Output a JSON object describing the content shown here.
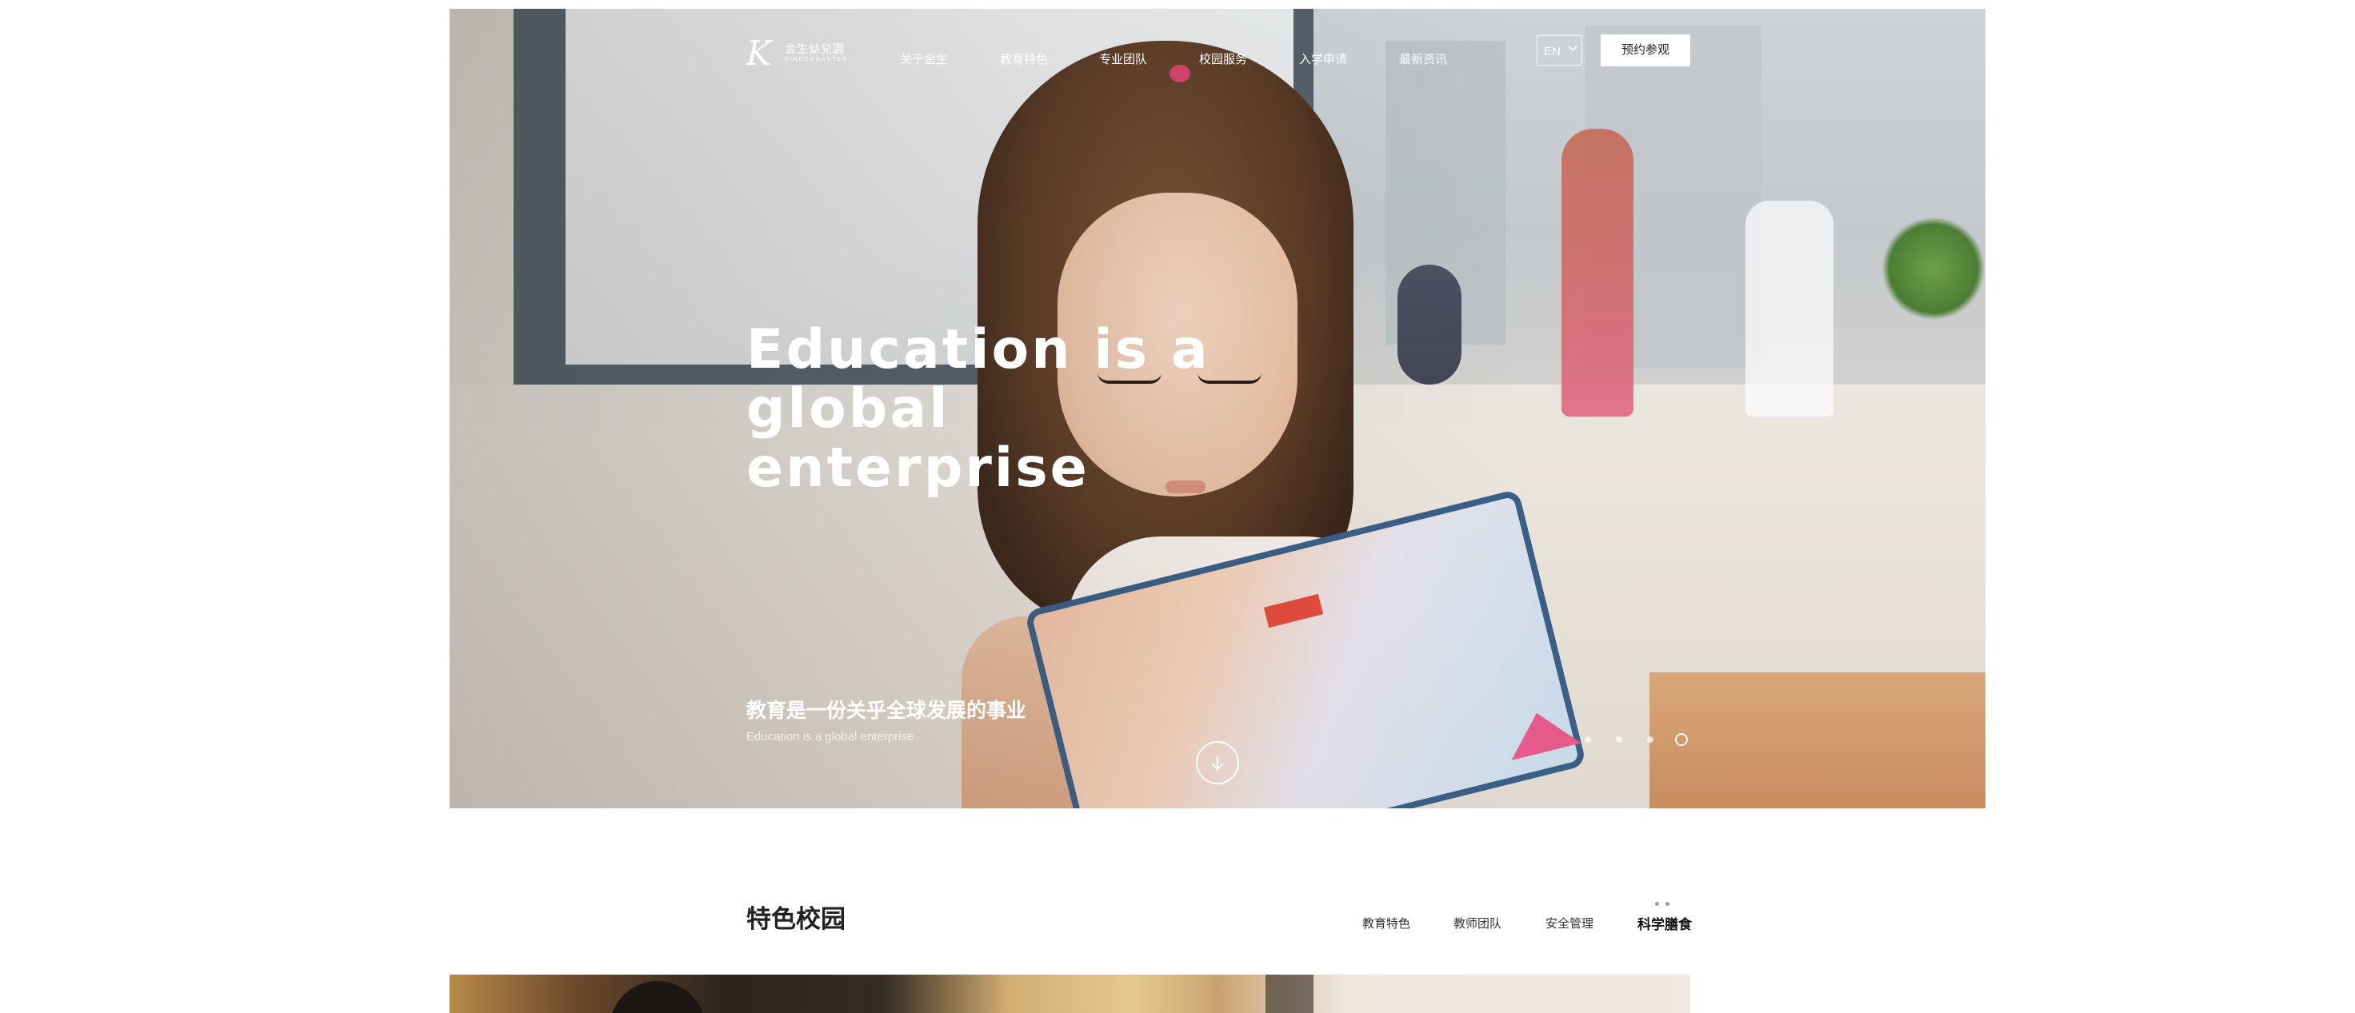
{
  "brand": {
    "logo_mark": "K",
    "name_cn": "金生幼兒園",
    "name_en": "KINDERGARTEN"
  },
  "nav": {
    "items": [
      "关于金生",
      "教育特色",
      "专业团队",
      "校园服务",
      "入学申请",
      "最新资讯"
    ],
    "language": "EN",
    "language_icon": "chevron-down-icon",
    "cta": "预约参观"
  },
  "hero": {
    "title_line1": "Education is a",
    "title_line2": "global enterprise",
    "subtitle_cn": "教育是一份关乎全球发展的事业",
    "subtitle_en": "Education is a global enterprise",
    "scroll_icon": "arrow-down-icon",
    "slides_total": 4,
    "slide_active": 4
  },
  "feature_section": {
    "title": "特色校园",
    "tabs": [
      "教育特色",
      "教师团队",
      "安全管理",
      "科学膳食"
    ],
    "active_tab": "科学膳食"
  },
  "colors": {
    "text_dark": "#222222",
    "white": "#ffffff",
    "inactive_dot": "#9a9a9a"
  }
}
